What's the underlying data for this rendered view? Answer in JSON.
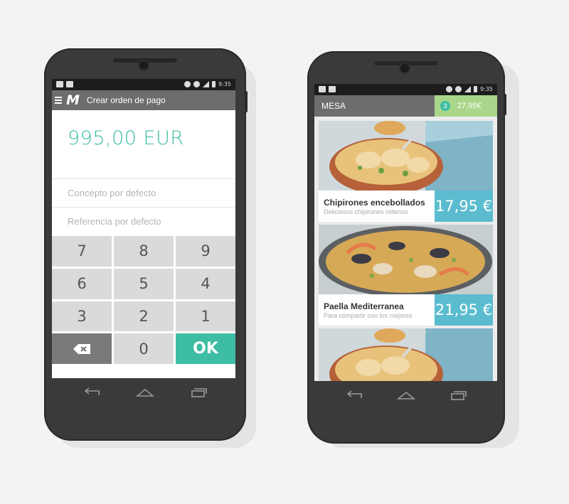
{
  "left_phone": {
    "status": {
      "time": "9:35"
    },
    "header": {
      "title": "Crear orden de pago",
      "logo": "M"
    },
    "amount": "995,00 EUR",
    "fields": {
      "concept_placeholder": "Concepto por defecto",
      "reference_placeholder": "Referencia por defecto"
    },
    "keypad": {
      "keys": [
        "7",
        "8",
        "9",
        "6",
        "5",
        "4",
        "3",
        "2",
        "1"
      ],
      "zero": "0",
      "ok": "OK",
      "backspace_icon": "backspace-icon"
    },
    "nav_icons": [
      "back-icon",
      "home-icon",
      "recents-icon"
    ]
  },
  "right_phone": {
    "status": {
      "time": "9:35"
    },
    "header": {
      "title": "MESA",
      "cart_count": "3",
      "cart_total": "27,95€"
    },
    "items": [
      {
        "name": "Chipirones encebollados",
        "description": "Deliciosos chipirones rellenos",
        "price": "17,95 €"
      },
      {
        "name": "Paella Mediterranea",
        "description": "Para compartir con los mejores",
        "price": "21,95 €"
      }
    ],
    "nav_icons": [
      "back-icon",
      "home-icon",
      "recents-icon"
    ]
  },
  "colors": {
    "accent_green": "#3dbda3",
    "price_blue": "#5bbccf",
    "cart_green": "#a9d68b",
    "toolbar_gray": "#6d6d6d",
    "keypad_gray": "#dadada"
  }
}
